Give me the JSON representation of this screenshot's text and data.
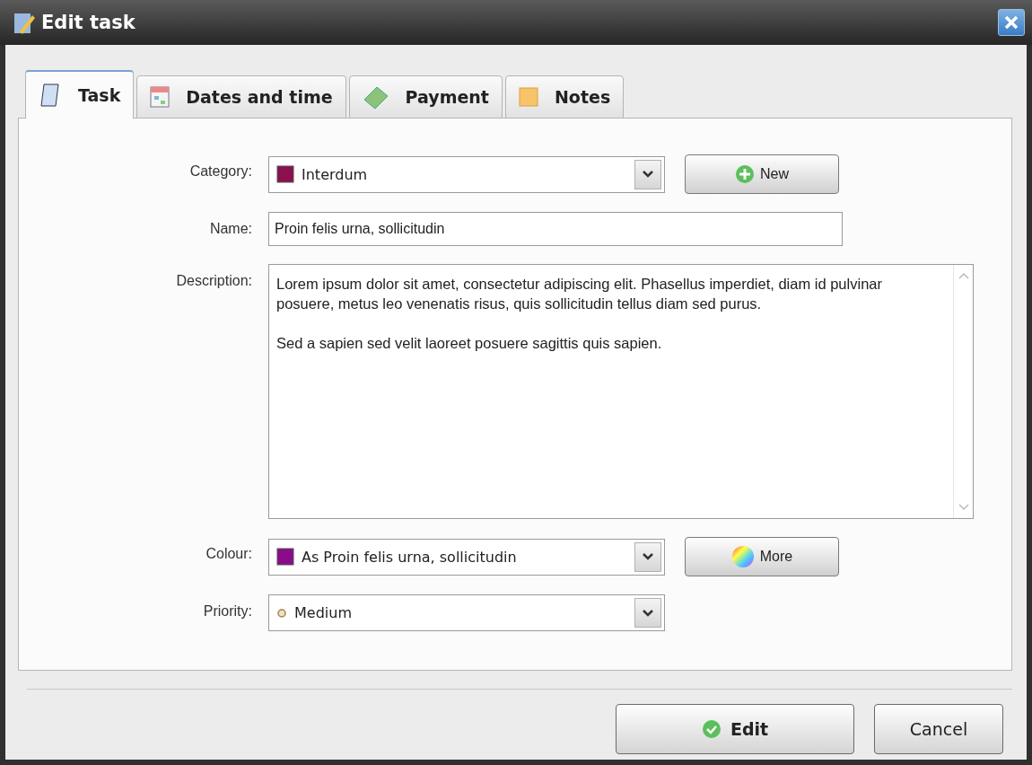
{
  "window": {
    "title": "Edit task"
  },
  "tabs": [
    {
      "label": "Task",
      "selected": true
    },
    {
      "label": "Dates and time",
      "selected": false
    },
    {
      "label": "Payment",
      "selected": false
    },
    {
      "label": "Notes",
      "selected": false
    }
  ],
  "form": {
    "category": {
      "label": "Category:",
      "value": "Interdum",
      "button": "New"
    },
    "name": {
      "label": "Name:",
      "value": "Proin felis urna, sollicitudin"
    },
    "description": {
      "label": "Description:",
      "value": "Lorem ipsum dolor sit amet, consectetur adipiscing elit. Phasellus imperdiet, diam id pulvinar posuere, metus leo venenatis risus, quis sollicitudin tellus diam sed purus.\n\nSed a sapien sed velit laoreet posuere sagittis quis sapien."
    },
    "colour": {
      "label": "Colour:",
      "value": "As Proin felis urna, sollicitudin",
      "button": "More"
    },
    "priority": {
      "label": "Priority:",
      "value": "Medium"
    }
  },
  "buttons": [
    {
      "label": "Edit",
      "default": true
    },
    {
      "label": "Cancel",
      "default": false
    }
  ]
}
